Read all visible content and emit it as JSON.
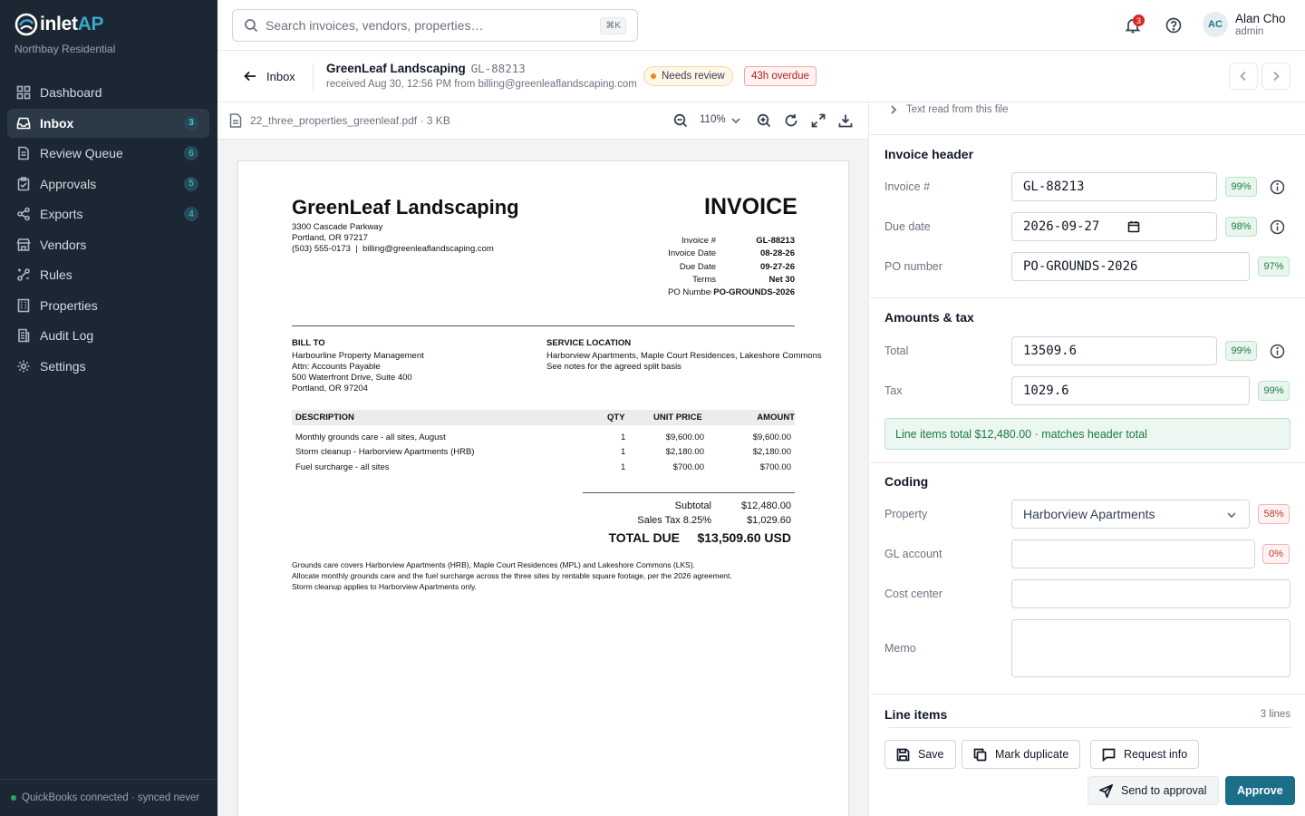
{
  "brand": {
    "name_main": "inlet",
    "name_accent": "AP",
    "org": "Northbay Residential"
  },
  "nav": [
    {
      "label": "Dashboard",
      "badge": ""
    },
    {
      "label": "Inbox",
      "badge": "3"
    },
    {
      "label": "Review Queue",
      "badge": "6"
    },
    {
      "label": "Approvals",
      "badge": "5"
    },
    {
      "label": "Exports",
      "badge": "4"
    },
    {
      "label": "Vendors",
      "badge": ""
    },
    {
      "label": "Rules",
      "badge": ""
    },
    {
      "label": "Properties",
      "badge": ""
    },
    {
      "label": "Audit Log",
      "badge": ""
    },
    {
      "label": "Settings",
      "badge": ""
    }
  ],
  "sidebar_footer": "QuickBooks connected · synced never",
  "search": {
    "placeholder": "Search invoices, vendors, properties…",
    "shortcut": "⌘K"
  },
  "notifications": {
    "count": "3"
  },
  "user": {
    "initials": "AC",
    "name": "Alan Cho",
    "role": "admin"
  },
  "doc_header": {
    "back_label": "Inbox",
    "vendor": "GreenLeaf Landscaping",
    "invoice_no": "GL-88213",
    "received": "received Aug 30, 12:56 PM from billing@greenleaflandscaping.com",
    "status": "Needs review",
    "overdue": "43h overdue"
  },
  "viewer": {
    "file": "22_three_properties_greenleaf.pdf · 3 KB",
    "zoom": "110%"
  },
  "invoice": {
    "vendor": "GreenLeaf Landscaping",
    "addr1": "3300 Cascade Parkway",
    "addr2": "Portland, OR 97217",
    "contact": "(503) 555-0173  |  billing@greenleaflandscaping.com",
    "doc_type": "INVOICE",
    "meta": [
      {
        "label": "Invoice #",
        "value": "GL-88213"
      },
      {
        "label": "Invoice Date",
        "value": "08-28-26"
      },
      {
        "label": "Due Date",
        "value": "09-27-26"
      },
      {
        "label": "Terms",
        "value": "Net 30"
      },
      {
        "label": "PO Number",
        "value": "PO-GROUNDS-2026"
      }
    ],
    "bill_to_title": "BILL TO",
    "bill_to": [
      "Harbourline Property Management",
      "Attn: Accounts Payable",
      "500 Waterfront Drive, Suite 400",
      "Portland, OR 97204"
    ],
    "service_title": "SERVICE LOCATION",
    "service": [
      "Harborview Apartments, Maple Court Residences, Lakeshore Commons",
      "See notes for the agreed split basis"
    ],
    "cols": {
      "desc": "DESCRIPTION",
      "qty": "QTY",
      "unit": "UNIT PRICE",
      "amount": "AMOUNT"
    },
    "lines": [
      {
        "desc": "Monthly grounds care - all sites, August",
        "qty": "1",
        "unit": "$9,600.00",
        "amount": "$9,600.00"
      },
      {
        "desc": "Storm cleanup - Harborview Apartments (HRB)",
        "qty": "1",
        "unit": "$2,180.00",
        "amount": "$2,180.00"
      },
      {
        "desc": "Fuel surcharge - all sites",
        "qty": "1",
        "unit": "$700.00",
        "amount": "$700.00"
      }
    ],
    "subtotal_label": "Subtotal",
    "subtotal": "$12,480.00",
    "tax_label": "Sales Tax 8.25%",
    "tax": "$1,029.60",
    "total_label": "TOTAL DUE",
    "total": "$13,509.60 USD",
    "notes": [
      "Grounds care covers Harborview Apartments (HRB), Maple Court Residences (MPL) and Lakeshore Commons (LKS).",
      "Allocate monthly grounds care and the fuel surcharge across the three sites by rentable square footage, per the 2026 agreement.",
      "Storm cleanup applies to Harborview Apartments only."
    ]
  },
  "panel": {
    "text_read": "Text read from this file",
    "header_title": "Invoice header",
    "invoice_label": "Invoice #",
    "invoice_value": "GL-88213",
    "invoice_conf": "99%",
    "due_label": "Due date",
    "due_value": "2026-09-27",
    "due_conf": "98%",
    "po_label": "PO number",
    "po_value": "PO-GROUNDS-2026",
    "po_conf": "97%",
    "amounts_title": "Amounts & tax",
    "total_label": "Total",
    "total_value": "13509.6",
    "total_conf": "99%",
    "tax_label": "Tax",
    "tax_value": "1029.6",
    "tax_conf": "99%",
    "match_note": "Line items total $12,480.00 · matches header total",
    "coding_title": "Coding",
    "property_label": "Property",
    "property_value": "Harborview Apartments",
    "property_conf": "58%",
    "gl_label": "GL account",
    "gl_value": "",
    "gl_conf": "0%",
    "cost_label": "Cost center",
    "cost_value": "",
    "memo_label": "Memo",
    "memo_value": "",
    "lines_title": "Line items",
    "lines_count": "3 lines"
  },
  "actions": {
    "save": "Save",
    "duplicate": "Mark duplicate",
    "request": "Request info",
    "send": "Send to approval",
    "approve": "Approve"
  },
  "colors": {
    "sidebar": "#1b2733",
    "accent": "#1b6e87",
    "success": "#1b7a45",
    "danger": "#c0392b"
  }
}
